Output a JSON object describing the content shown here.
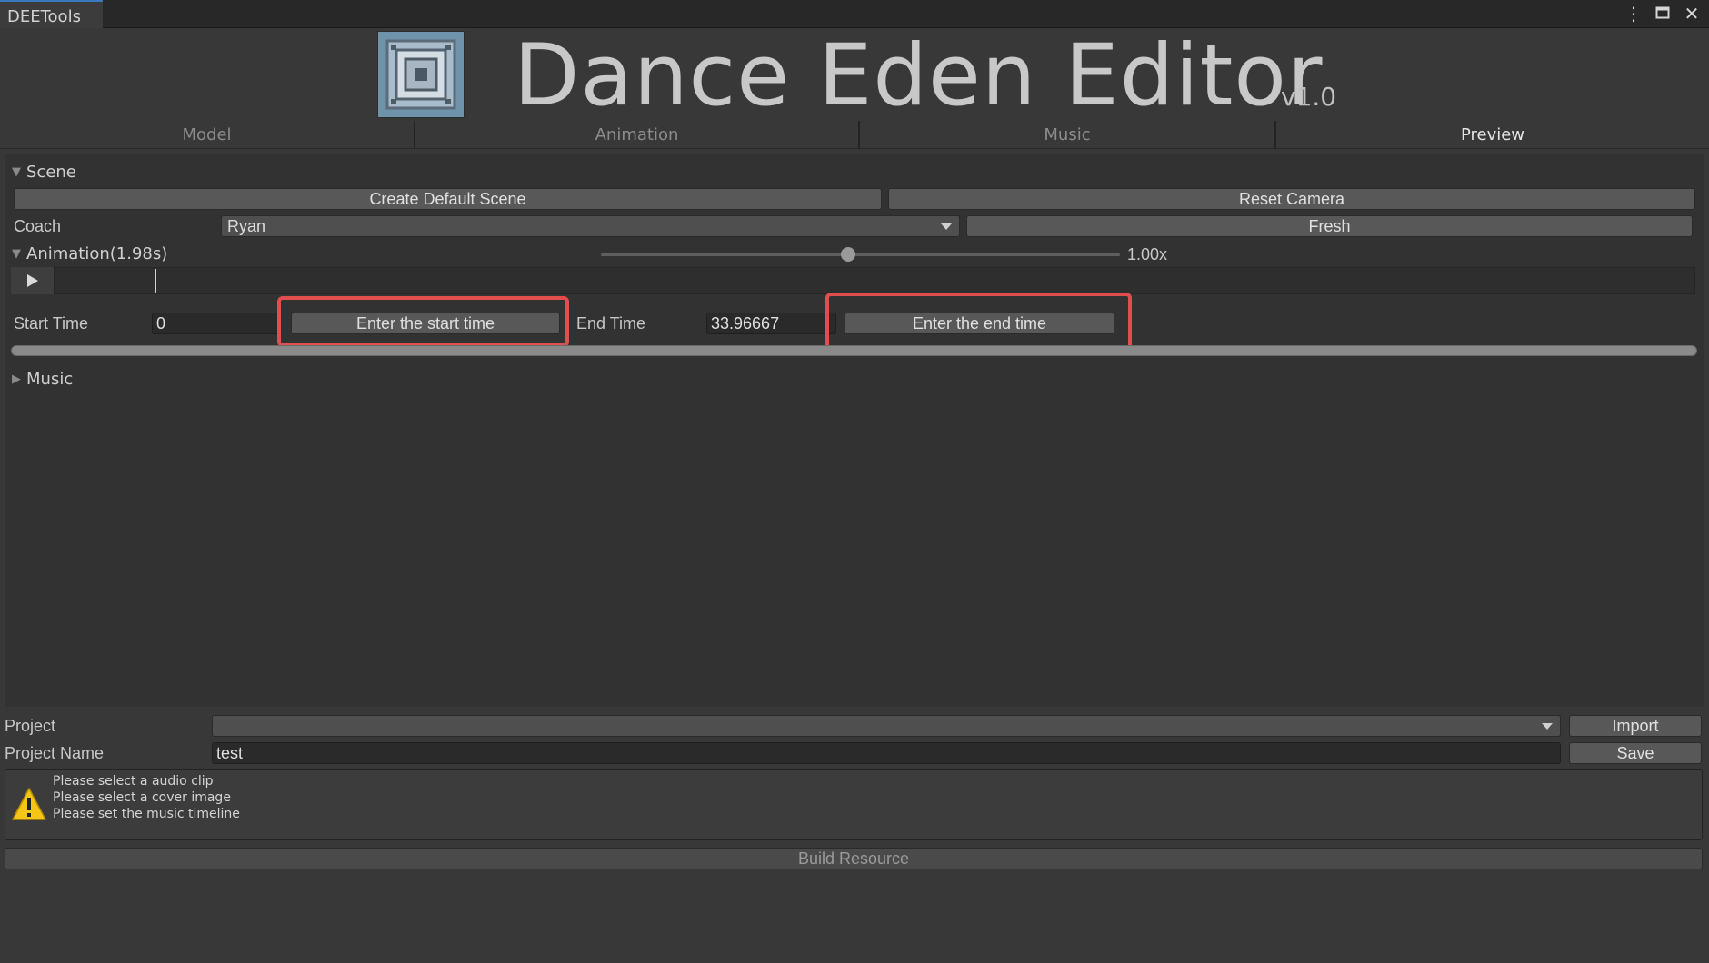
{
  "window": {
    "tab_title": "DEETools",
    "controls": {
      "menu_icon": "kebab-menu-icon",
      "maximize_icon": "maximize-icon",
      "close_icon": "close-icon"
    }
  },
  "header": {
    "title": "Dance Eden Editor",
    "version": "v1.0",
    "logo_icon": "qr-logo-icon"
  },
  "main_tabs": [
    {
      "label": "Model",
      "active": false
    },
    {
      "label": "Animation",
      "active": false
    },
    {
      "label": "Music",
      "active": false
    },
    {
      "label": "Preview",
      "active": true
    }
  ],
  "scene": {
    "label": "Scene",
    "create_default_scene": "Create Default Scene",
    "reset_camera": "Reset Camera",
    "coach_label": "Coach",
    "coach_value": "Ryan",
    "fresh": "Fresh"
  },
  "animation": {
    "label": "Animation(1.98s)",
    "speed_label": "1.00x",
    "speed_value": 1.0,
    "play_icon": "play-icon",
    "start_time_label": "Start Time",
    "start_time_value": "0",
    "enter_start_button": "Enter the start time",
    "end_time_label": "End Time",
    "end_time_value": "33.96667",
    "enter_end_button": "Enter the end time"
  },
  "music": {
    "label": "Music"
  },
  "project": {
    "project_label": "Project",
    "project_value": "",
    "import_button": "Import",
    "name_label": "Project Name",
    "name_value": "test",
    "save_button": "Save"
  },
  "help_box": {
    "icon": "warning-icon",
    "lines": [
      "Please select a audio clip",
      "Please select a cover image",
      "Please set the music timeline"
    ]
  },
  "build_button": "Build Resource",
  "colors": {
    "highlight": "#e04e4e",
    "accent_tab": "#3a79bb"
  }
}
